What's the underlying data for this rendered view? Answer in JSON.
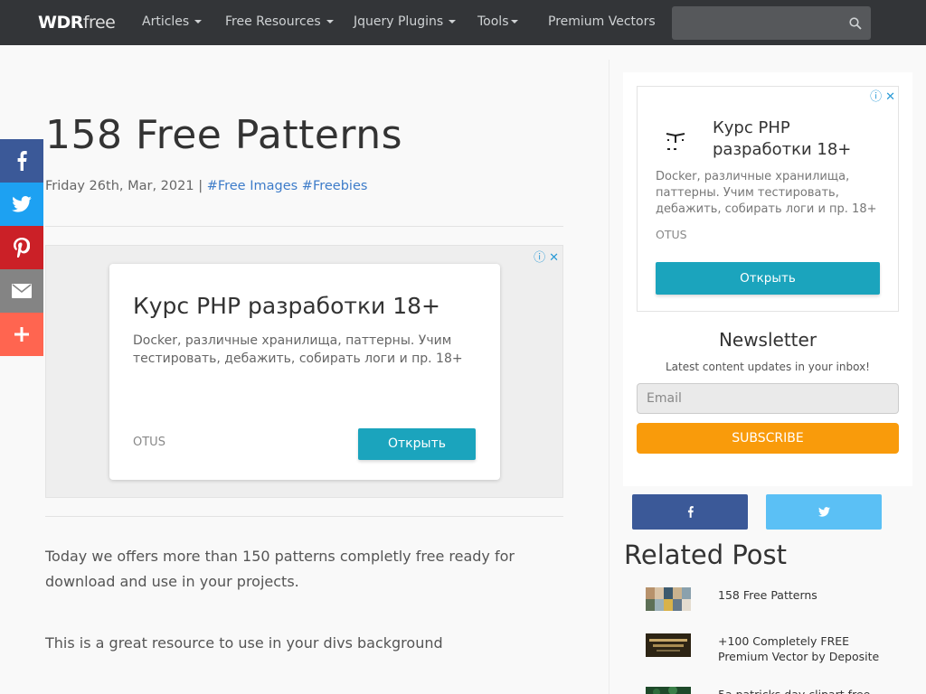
{
  "nav": {
    "brand_bold": "WDR",
    "brand_light": "free",
    "items": [
      {
        "label": "Articles",
        "dropdown": true
      },
      {
        "label": "Free Resources",
        "dropdown": true
      },
      {
        "label": "Jquery Plugins",
        "dropdown": true
      },
      {
        "label": "Tools",
        "dropdown": true
      },
      {
        "label": "Premium Vectors",
        "dropdown": false
      }
    ],
    "search_placeholder": ""
  },
  "article": {
    "title": "158 Free Patterns",
    "date": "Friday 26th, Mar, 2021",
    "separator": "|",
    "tags": [
      "#Free Images",
      "#Freebies"
    ],
    "paragraphs": [
      "Today we offers more than 150 patterns completly free ready for download and use in your projects.",
      "This is a great resource to use in your divs background"
    ]
  },
  "ad_main": {
    "title": "Курс PHP разработки 18+",
    "description": "Docker, различные хранилища, паттерны. Учим тестировать, дебажить, собирать логи и пр. 18+",
    "brand": "OTUS",
    "button": "Открыть"
  },
  "ad_side": {
    "title": "Курс PHP разработки 18+",
    "description": "Docker, различные хранилища, паттерны. Учим тестировать, дебажить, собирать логи и пр. 18+",
    "brand": "OTUS",
    "button": "Открыть"
  },
  "share": [
    {
      "icon": "facebook-icon",
      "color": "#3b5998"
    },
    {
      "icon": "twitter-icon",
      "color": "#1da1f2"
    },
    {
      "icon": "pinterest-icon",
      "color": "#cb2027"
    },
    {
      "icon": "email-icon",
      "color": "#848484"
    },
    {
      "icon": "plus-icon",
      "color": "#ff6550"
    }
  ],
  "newsletter": {
    "title": "Newsletter",
    "subtitle": "Latest content updates in your inbox!",
    "email_placeholder": "Email",
    "button": "SUBSCRIBE"
  },
  "social_buttons": [
    {
      "icon": "facebook-icon",
      "color": "#3b5998"
    },
    {
      "icon": "twitter-icon",
      "color": "#5bc0f5"
    }
  ],
  "related": {
    "title": "Related Post",
    "items": [
      {
        "title": "158 Free Patterns"
      },
      {
        "title": "+100 Completely FREE Premium Vector by Deposite"
      },
      {
        "title": "5a patricks day clipart free"
      }
    ]
  }
}
